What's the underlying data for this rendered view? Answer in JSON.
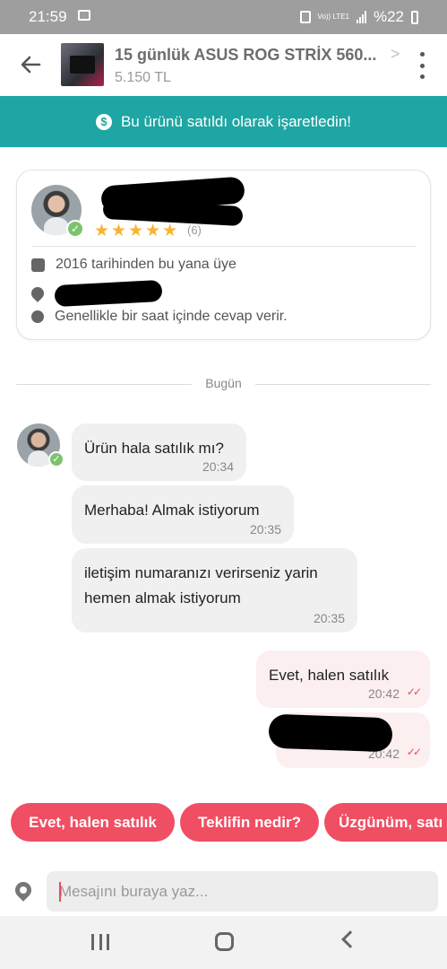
{
  "status_bar": {
    "time": "21:59",
    "network": "Vo)) LTE1",
    "battery": "%22"
  },
  "header": {
    "product_title": "15 günlük ASUS ROG STRİX 560...",
    "price": "5.150 TL"
  },
  "banner": {
    "icon": "$",
    "text": "Bu ürünü satıldı olarak işaretledin!"
  },
  "profile": {
    "stars": "★★★★★",
    "rating_count": "(6)",
    "member_since": "2016 tarihinden bu yana üye",
    "response_time": "Genellikle bir saat içinde cevap verir.",
    "verified_mark": "✓"
  },
  "date_separator": "Bugün",
  "messages": [
    {
      "direction": "in",
      "text": "Ürün hala satılık mı?",
      "time": "20:34"
    },
    {
      "direction": "in",
      "text": "Merhaba! Almak istiyorum",
      "time": "20:35"
    },
    {
      "direction": "in",
      "text": "iletişim numaranızı verirseniz yarin hemen almak istiyorum",
      "time": "20:35"
    },
    {
      "direction": "out",
      "text": "Evet, halen satılık",
      "time": "20:42",
      "ticks": "✓✓"
    },
    {
      "direction": "out",
      "text": "",
      "time": "20:42",
      "ticks": "✓✓"
    }
  ],
  "quick_replies": [
    "Evet, halen satılık",
    "Teklifin nedir?",
    "Üzgünüm, satı"
  ],
  "input": {
    "placeholder": "Mesajını buraya yaz..."
  },
  "colors": {
    "banner": "#1da6a3",
    "chip": "#f04e63",
    "incoming_bubble": "#f0f0f0",
    "outgoing_bubble": "#fbeff0",
    "stars": "#f5b52f",
    "verified": "#7cc36d"
  }
}
